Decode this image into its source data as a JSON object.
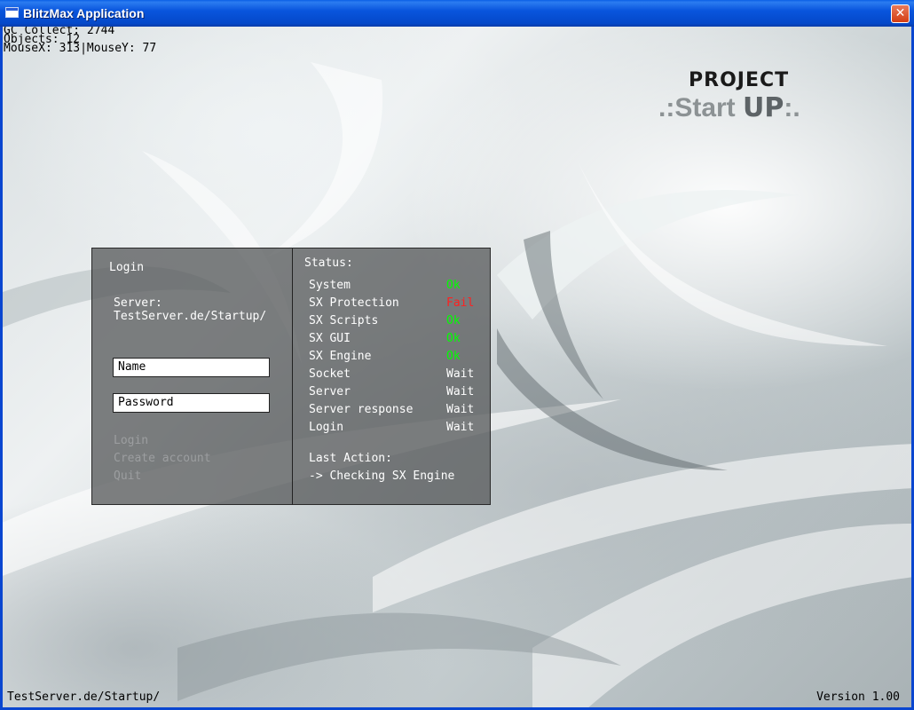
{
  "window": {
    "title": "BlitzMax Application",
    "close_symbol": "✕"
  },
  "debug": {
    "gc_collect": "GC Collect: 2744",
    "objects": "Objects: 12",
    "mouse": "MouseX: 313|MouseY: 77"
  },
  "logo": {
    "project": "PROJECT",
    "start_prefix": ".:Start ",
    "up": "UP",
    "start_suffix": ":."
  },
  "login": {
    "title": "Login",
    "server_label": "Server:",
    "server_value": "TestServer.de/Startup/",
    "name_value": "Name",
    "password_value": "Password",
    "menu": {
      "login": "Login",
      "create_account": "Create account",
      "quit": "Quit"
    }
  },
  "status": {
    "title": "Status:",
    "items": [
      {
        "label": "System",
        "state": "Ok"
      },
      {
        "label": "SX Protection",
        "state": "Fail"
      },
      {
        "label": "SX Scripts",
        "state": "Ok"
      },
      {
        "label": "SX GUI",
        "state": "Ok"
      },
      {
        "label": "SX Engine",
        "state": "Ok"
      },
      {
        "label": "Socket",
        "state": "Wait"
      },
      {
        "label": "Server",
        "state": "Wait"
      },
      {
        "label": "Server response",
        "state": "Wait"
      },
      {
        "label": "Login",
        "state": "Wait"
      }
    ],
    "last_action_label": "Last Action:",
    "last_action_value": "-> Checking SX Engine"
  },
  "footer": {
    "server": "TestServer.de/Startup/",
    "version": "Version 1.00"
  },
  "colors": {
    "ok": "#00ff00",
    "fail": "#ff2020",
    "wait": "#ffffff",
    "titlebar": "#0955dd"
  }
}
